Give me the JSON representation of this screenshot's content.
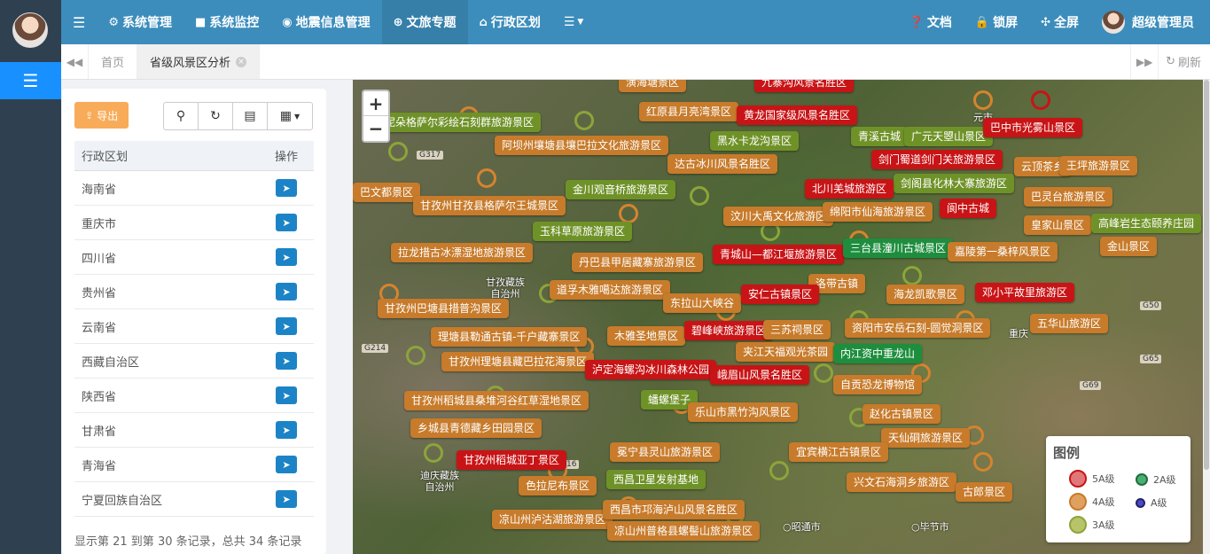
{
  "topbar": {
    "menu_toggle_icon": "bars-icon",
    "nav": [
      {
        "label": "系统管理",
        "icon": "gear-icon"
      },
      {
        "label": "系统监控",
        "icon": "video-icon"
      },
      {
        "label": "地震信息管理",
        "icon": "pin-icon"
      },
      {
        "label": "文旅专题",
        "icon": "globe-icon"
      },
      {
        "label": "行政区划",
        "icon": "bank-icon"
      }
    ],
    "right": {
      "docs": "文档",
      "lock": "锁屏",
      "fullscreen": "全屏",
      "user": "超级管理员"
    }
  },
  "tabs": {
    "home": "首页",
    "active": "省级风景区分析",
    "refresh": "刷新"
  },
  "panel": {
    "export_label": "导出",
    "columns": [
      "行政区划",
      "操作"
    ],
    "rows": [
      "海南省",
      "重庆市",
      "四川省",
      "贵州省",
      "云南省",
      "西藏自治区",
      "陕西省",
      "甘肃省",
      "青海省",
      "宁夏回族自治区"
    ],
    "footer": "显示第 21 到第 30 条记录，总共 34 条记录"
  },
  "map": {
    "zoom_in": "+",
    "zoom_out": "−",
    "labels": [
      {
        "text": "九寨沟风景名胜区",
        "level": "5"
      },
      {
        "text": "红原县月亮湾景区",
        "level": "4"
      },
      {
        "text": "黄龙国家级风景名胜区",
        "level": "5"
      },
      {
        "text": "泥朵格萨尔彩绘石刻群旅游景区",
        "level": "3"
      },
      {
        "text": "阿坝州壤塘县壤巴拉文化旅游景区",
        "level": "4"
      },
      {
        "text": "黑水卡龙沟景区",
        "level": "3"
      },
      {
        "text": "达古冰川风景名胜区",
        "level": "4"
      },
      {
        "text": "青溪古城",
        "level": "3"
      },
      {
        "text": "广元天曌山景区",
        "level": "3"
      },
      {
        "text": "巴中市光雾山景区",
        "level": "5"
      },
      {
        "text": "剑门蜀道剑门关旅游景区",
        "level": "5"
      },
      {
        "text": "王坪旅游景区",
        "level": "4"
      },
      {
        "text": "剑阁县化林大寨旅游区",
        "level": "3"
      },
      {
        "text": "金川观音桥旅游景区",
        "level": "3"
      },
      {
        "text": "北川羌城旅游区",
        "level": "5"
      },
      {
        "text": "巴灵台旅游景区",
        "level": "4"
      },
      {
        "text": "甘孜州甘孜县格萨尔王城景区",
        "level": "4"
      },
      {
        "text": "汶川大禹文化旅游区",
        "level": "4"
      },
      {
        "text": "绵阳市仙海旅游景区",
        "level": "4"
      },
      {
        "text": "阆中古城",
        "level": "5"
      },
      {
        "text": "皇家山景区",
        "level": "4"
      },
      {
        "text": "高峰岩生态颐养庄园",
        "level": "3"
      },
      {
        "text": "玉科草原旅游景区",
        "level": "3"
      },
      {
        "text": "青城山—都江堰旅游景区",
        "level": "5"
      },
      {
        "text": "三台县潼川古城景区",
        "level": "2"
      },
      {
        "text": "嘉陵第一桑梓风景区",
        "level": "4"
      },
      {
        "text": "金山景区",
        "level": "4"
      },
      {
        "text": "拉龙措古冰漂湿地旅游景区",
        "level": "4"
      },
      {
        "text": "丹巴县甲居藏寨旅游景区",
        "level": "4"
      },
      {
        "text": "洛带古镇",
        "level": "4"
      },
      {
        "text": "道孚木雅噶达旅游景区",
        "level": "4"
      },
      {
        "text": "东拉山大峡谷",
        "level": "4"
      },
      {
        "text": "安仁古镇景区",
        "level": "5"
      },
      {
        "text": "海龙凯歌景区",
        "level": "4"
      },
      {
        "text": "邓小平故里旅游区",
        "level": "5"
      },
      {
        "text": "甘孜州巴塘县措普沟景区",
        "level": "4"
      },
      {
        "text": "五华山旅游区",
        "level": "4"
      },
      {
        "text": "理塘县勒通古镇-千户藏寨景区",
        "level": "4"
      },
      {
        "text": "木雅圣地景区",
        "level": "4"
      },
      {
        "text": "碧峰峡旅游景区",
        "level": "5"
      },
      {
        "text": "三苏祠景区",
        "level": "4"
      },
      {
        "text": "资阳市安岳石刻-圆觉洞景区",
        "level": "4"
      },
      {
        "text": "夹江天福观光茶园",
        "level": "4"
      },
      {
        "text": "内江资中重龙山",
        "level": "2"
      },
      {
        "text": "甘孜州理塘县藏巴拉花海景区",
        "level": "4"
      },
      {
        "text": "泸定海螺沟冰川森林公园",
        "level": "5"
      },
      {
        "text": "峨眉山风景名胜区",
        "level": "5"
      },
      {
        "text": "自贡恐龙博物馆",
        "level": "4"
      },
      {
        "text": "甘孜州稻城县桑堆河谷红草湿地景区",
        "level": "4"
      },
      {
        "text": "蟠螺堡子",
        "level": "3"
      },
      {
        "text": "乐山市黑竹沟风景区",
        "level": "4"
      },
      {
        "text": "赵化古镇景区",
        "level": "4"
      },
      {
        "text": "乡城县青德藏乡田园景区",
        "level": "4"
      },
      {
        "text": "天仙硐旅游景区",
        "level": "4"
      },
      {
        "text": "冕宁县灵山旅游景区",
        "level": "4"
      },
      {
        "text": "宜宾横江古镇景区",
        "level": "4"
      },
      {
        "text": "甘孜州稻城亚丁景区",
        "level": "5"
      },
      {
        "text": "色拉尼布景区",
        "level": "4"
      },
      {
        "text": "西昌卫星发射基地",
        "level": "3"
      },
      {
        "text": "兴文石海洞乡旅游区",
        "level": "4"
      },
      {
        "text": "古郎景区",
        "level": "4"
      },
      {
        "text": "凉山州泸沽湖旅游景区",
        "level": "4"
      },
      {
        "text": "西昌市邛海泸山风景名胜区",
        "level": "4"
      },
      {
        "text": "凉山州普格县螺髻山旅游景区",
        "level": "4"
      },
      {
        "text": "巴文都景区",
        "level": "4"
      },
      {
        "text": "潢海塘景区",
        "level": "4"
      },
      {
        "text": "云顶茶乡",
        "level": "4"
      }
    ],
    "place_names": {
      "ganzi": "甘孜藏族\n自治州",
      "diqing": "迪庆藏族\n自治州",
      "zhaotong": "○昭通市",
      "bijie": "○毕节市",
      "chongqing": "重庆",
      "yuan": "元市"
    },
    "roads": [
      "G317",
      "G214",
      "G50",
      "G65",
      "G69",
      "16"
    ],
    "legend": {
      "title": "图例",
      "items": [
        {
          "label": "5A级",
          "color": "#d9534f"
        },
        {
          "label": "2A级",
          "color": "#1e8e3e"
        },
        {
          "label": "4A级",
          "color": "#e0a060"
        },
        {
          "label": "A级",
          "color": "#3a3aa8"
        },
        {
          "label": "3A级",
          "color": "#8da43a"
        }
      ]
    }
  }
}
